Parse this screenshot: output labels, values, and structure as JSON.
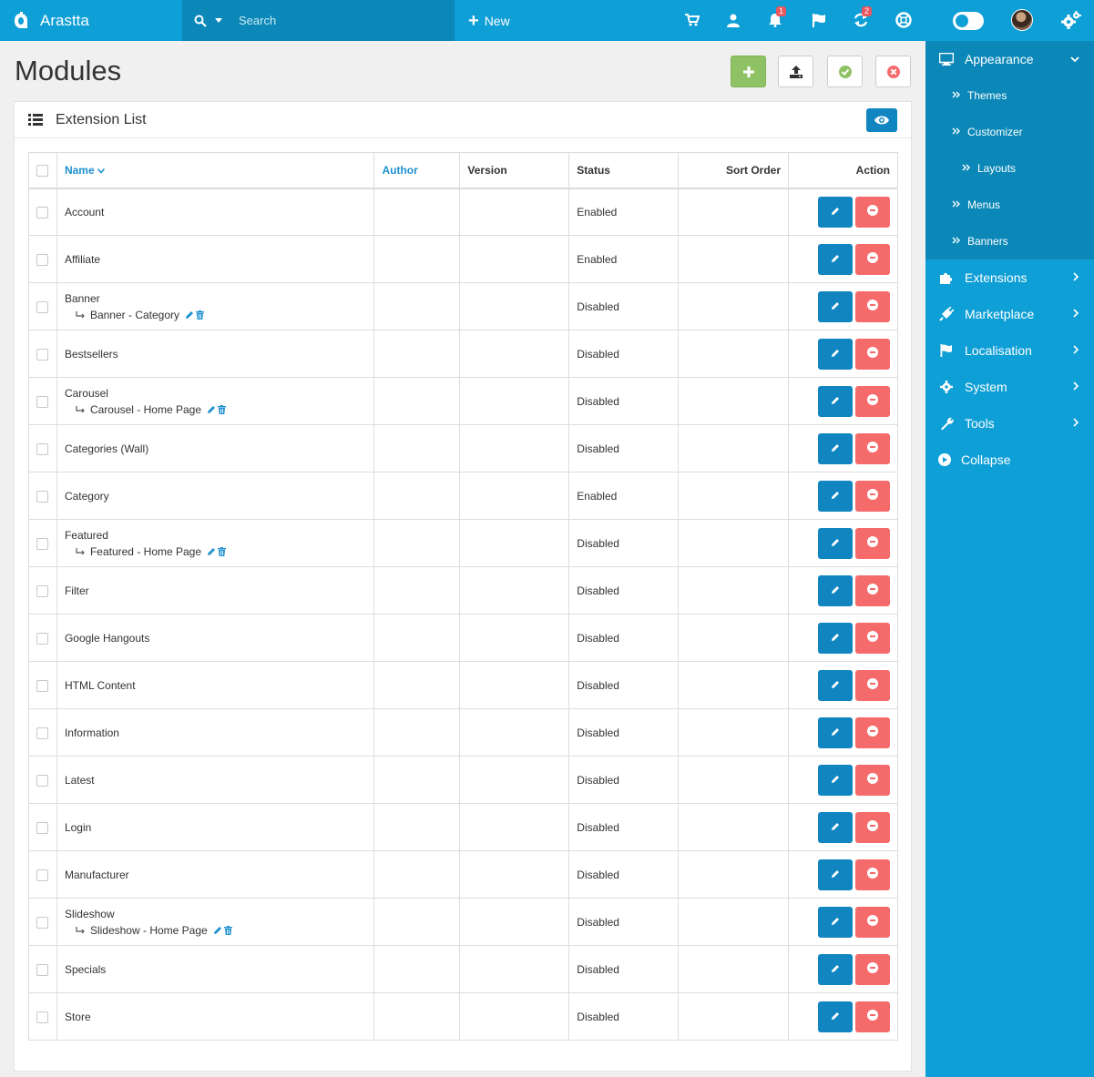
{
  "topbar": {
    "brand": "Arastta",
    "search_placeholder": "Search",
    "new_label": "New",
    "notification_count": "1",
    "refresh_count": "2"
  },
  "page": {
    "title": "Modules",
    "panel_title": "Extension List"
  },
  "table": {
    "headers": {
      "name": "Name",
      "author": "Author",
      "version": "Version",
      "status": "Status",
      "sort_order": "Sort Order",
      "action": "Action"
    },
    "rows": [
      {
        "name": "Account",
        "status": "Enabled",
        "sub": ""
      },
      {
        "name": "Affiliate",
        "status": "Enabled",
        "sub": ""
      },
      {
        "name": "Banner",
        "status": "Disabled",
        "sub": "Banner - Category"
      },
      {
        "name": "Bestsellers",
        "status": "Disabled",
        "sub": ""
      },
      {
        "name": "Carousel",
        "status": "Disabled",
        "sub": "Carousel - Home Page"
      },
      {
        "name": "Categories (Wall)",
        "status": "Disabled",
        "sub": ""
      },
      {
        "name": "Category",
        "status": "Enabled",
        "sub": ""
      },
      {
        "name": "Featured",
        "status": "Disabled",
        "sub": "Featured - Home Page"
      },
      {
        "name": "Filter",
        "status": "Disabled",
        "sub": ""
      },
      {
        "name": "Google Hangouts",
        "status": "Disabled",
        "sub": ""
      },
      {
        "name": "HTML Content",
        "status": "Disabled",
        "sub": ""
      },
      {
        "name": "Information",
        "status": "Disabled",
        "sub": ""
      },
      {
        "name": "Latest",
        "status": "Disabled",
        "sub": ""
      },
      {
        "name": "Login",
        "status": "Disabled",
        "sub": ""
      },
      {
        "name": "Manufacturer",
        "status": "Disabled",
        "sub": ""
      },
      {
        "name": "Slideshow",
        "status": "Disabled",
        "sub": "Slideshow - Home Page"
      },
      {
        "name": "Specials",
        "status": "Disabled",
        "sub": ""
      },
      {
        "name": "Store",
        "status": "Disabled",
        "sub": ""
      }
    ]
  },
  "sidebar": {
    "appearance": "Appearance",
    "subitems": [
      {
        "label": "Themes",
        "level": 1
      },
      {
        "label": "Customizer",
        "level": 1
      },
      {
        "label": "Layouts",
        "level": 2
      },
      {
        "label": "Menus",
        "level": 1
      },
      {
        "label": "Banners",
        "level": 1
      }
    ],
    "items": [
      {
        "label": "Extensions",
        "icon": "puzzle-icon"
      },
      {
        "label": "Marketplace",
        "icon": "plug-icon"
      },
      {
        "label": "Localisation",
        "icon": "flag-icon"
      },
      {
        "label": "System",
        "icon": "cog-icon"
      },
      {
        "label": "Tools",
        "icon": "wrench-icon"
      }
    ],
    "collapse": "Collapse"
  },
  "colors": {
    "primary": "#0e9fd6",
    "primary_dark": "#0b88b8",
    "edit": "#1085c0",
    "delete": "#f56b6b",
    "success": "#8fc265"
  }
}
